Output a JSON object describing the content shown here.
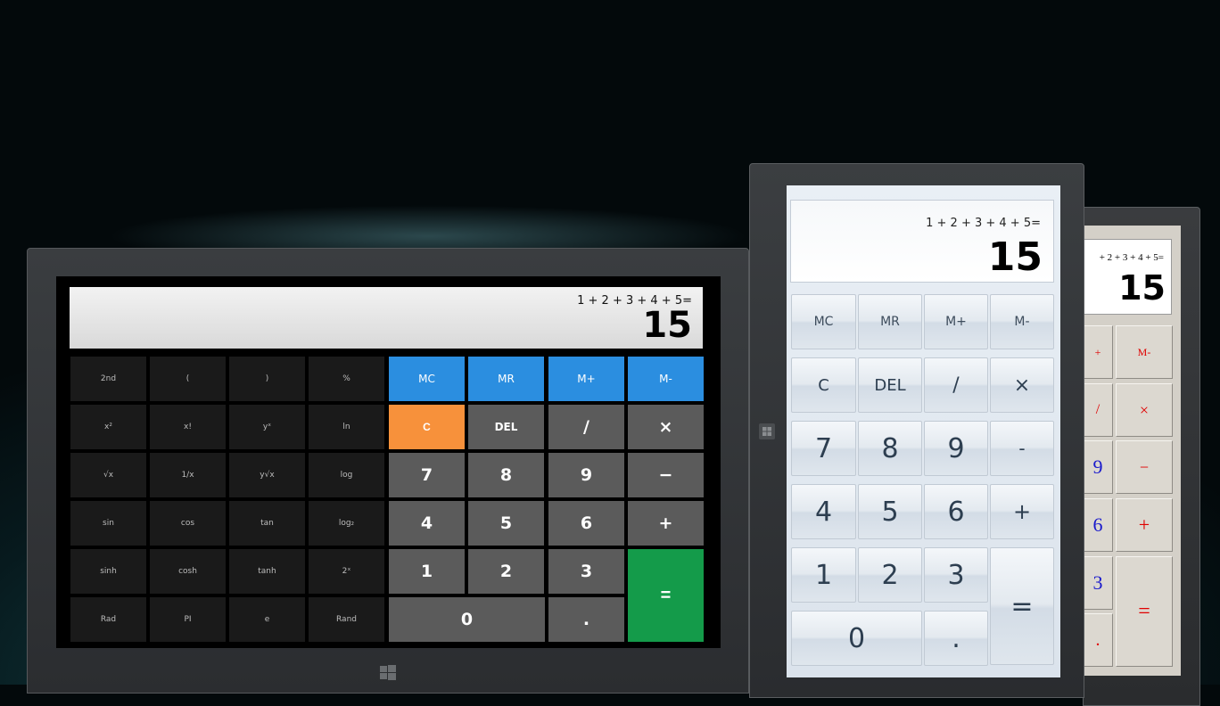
{
  "landscape": {
    "display": {
      "expression": "1 + 2 + 3 + 4 + 5=",
      "result": "15"
    },
    "sci_keys": [
      "2nd",
      "(",
      ")",
      "%",
      "x²",
      "x!",
      "yˣ",
      "ln",
      "√x",
      "1/x",
      "y√x",
      "log",
      "sin",
      "cos",
      "tan",
      "log₂",
      "sinh",
      "cosh",
      "tanh",
      "2ˣ",
      "Rad",
      "PI",
      "e",
      "Rand"
    ],
    "memory_keys": [
      "MC",
      "MR",
      "M+",
      "M-"
    ],
    "clear_key": "C",
    "delete_key": "DEL",
    "op_keys": [
      "/",
      "×",
      "−",
      "+"
    ],
    "digit_keys": [
      "7",
      "8",
      "9",
      "4",
      "5",
      "6",
      "1",
      "2",
      "3",
      "0"
    ],
    "dot_key": ".",
    "equals_key": "="
  },
  "portrait": {
    "display": {
      "expression": "1 + 2 + 3 + 4 + 5=",
      "result": "15"
    },
    "memory_keys": [
      "MC",
      "MR",
      "M+",
      "M-"
    ],
    "row2": [
      "C",
      "DEL",
      "/",
      "×"
    ],
    "digits": [
      "7",
      "8",
      "9",
      "4",
      "5",
      "6",
      "1",
      "2",
      "3",
      "0"
    ],
    "minus": "-",
    "plus": "+",
    "dot": ".",
    "equals": "="
  },
  "right": {
    "display": {
      "expression": "+ 2 + 3 + 4 + 5=",
      "result": "15"
    },
    "keys": [
      "+",
      "M-",
      "/",
      "×",
      "9",
      "−",
      "6",
      "+",
      "3",
      "=",
      "."
    ]
  },
  "colors": {
    "memory": "#2b8ee0",
    "clear": "#f7913b",
    "equals": "#149b4a",
    "gray_key": "#5b5b5b"
  }
}
